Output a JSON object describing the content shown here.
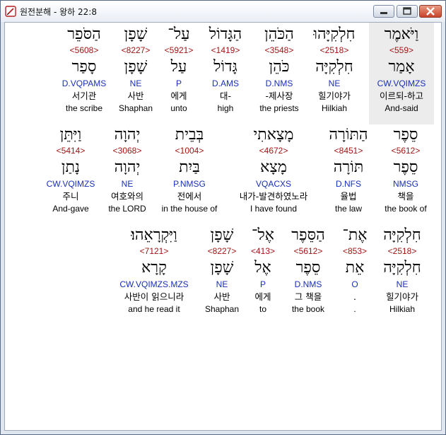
{
  "window": {
    "title": "원전분해 - 왕하 22:8",
    "controls": {
      "minimize": "minimize",
      "maximize": "maximize",
      "close": "close"
    }
  },
  "verse": {
    "rows": [
      {
        "words": [
          {
            "surface": "וַיֹּאמֶר",
            "strong": "<559>",
            "lemma": "אָמַר",
            "parse": "CW.VQIMZS",
            "korean": "이르되-하고",
            "english": "And-said",
            "selected": true
          },
          {
            "surface": "חִלְקִיָּהוּ",
            "strong": "<2518>",
            "lemma": "חִלְקִיָּה",
            "parse": "NE",
            "korean": "힐기야가",
            "english": "Hilkiah"
          },
          {
            "surface": "הַכֹּהֵן",
            "strong": "<3548>",
            "lemma": "כֹּהֵן",
            "parse": "D.NMS",
            "korean": "-제사장",
            "english": "the priests"
          },
          {
            "surface": "הַגָּדוֹל",
            "strong": "<1419>",
            "lemma": "גָּדוֹל",
            "parse": "D.AMS",
            "korean": "대-",
            "english": "high"
          },
          {
            "surface": "עַל־",
            "strong": "<5921>",
            "lemma": "עַל",
            "parse": "P",
            "korean": "에게",
            "english": "unto"
          },
          {
            "surface": "שָׁפָן",
            "strong": "<8227>",
            "lemma": "שָׁפָן",
            "parse": "NE",
            "korean": "사반",
            "english": "Shaphan"
          },
          {
            "surface": "הַסֹּפֵר",
            "strong": "<5608>",
            "lemma": "סָפַר",
            "parse": "D.VQPAMS",
            "korean": "서기관",
            "english": "the scribe"
          }
        ]
      },
      {
        "words": [
          {
            "surface": "סֵפֶר",
            "strong": "<5612>",
            "lemma": "סֵפֶר",
            "parse": "NMSG",
            "korean": "책을",
            "english": "the book of"
          },
          {
            "surface": "הַתּוֹרָה",
            "strong": "<8451>",
            "lemma": "תּוֹרָה",
            "parse": "D.NFS",
            "korean": "율법",
            "english": "the law"
          },
          {
            "surface": "מָצָאתִי",
            "strong": "<4672>",
            "lemma": "מָצָא",
            "parse": "VQACXS",
            "korean": "내가-발견하였노라",
            "english": "I have found"
          },
          {
            "surface": "בְּבֵית",
            "strong": "<1004>",
            "lemma": "בַּיִת",
            "parse": "P.NMSG",
            "korean": "전에서",
            "english": "in the house of"
          },
          {
            "surface": "יְהוָה",
            "strong": "<3068>",
            "lemma": "יְהוָה",
            "parse": "NE",
            "korean": "여호와의",
            "english": "the LORD"
          },
          {
            "surface": "וַיִּתֵּן",
            "strong": "<5414>",
            "lemma": "נָתַן",
            "parse": "CW.VQIMZS",
            "korean": "주니",
            "english": "And-gave"
          }
        ]
      },
      {
        "words": [
          {
            "surface": "חִלְקִיָּה",
            "strong": "<2518>",
            "lemma": "חִלְקִיָּה",
            "parse": "NE",
            "korean": "힐기야가",
            "english": "Hilkiah"
          },
          {
            "surface": "אֶת־",
            "strong": "<853>",
            "lemma": "אֵת",
            "parse": "O",
            "korean": ".",
            "english": "."
          },
          {
            "surface": "הַסֵּפֶר",
            "strong": "<5612>",
            "lemma": "סֵפֶר",
            "parse": "D.NMS",
            "korean": "그 책을",
            "english": "the book"
          },
          {
            "surface": "אֶל־",
            "strong": "<413>",
            "lemma": "אֶל",
            "parse": "P",
            "korean": "에게",
            "english": "to"
          },
          {
            "surface": "שָׁפָן",
            "strong": "<8227>",
            "lemma": "שָׁפָן",
            "parse": "NE",
            "korean": "사반",
            "english": "Shaphan"
          },
          {
            "surface": "וַיִּקְרָאֵהוּ׃",
            "strong": "<7121>",
            "lemma": "קָרָא",
            "parse": "CW.VQIMZS.MZS",
            "korean": "사반이 읽으니라",
            "english": "and he read it"
          }
        ]
      }
    ]
  },
  "colors": {
    "strong": "#a11414",
    "parse": "#1a2fb8",
    "hebrew": "#000000",
    "selection": "#ececec"
  },
  "icons": {
    "app": "scroll-pen-icon"
  }
}
